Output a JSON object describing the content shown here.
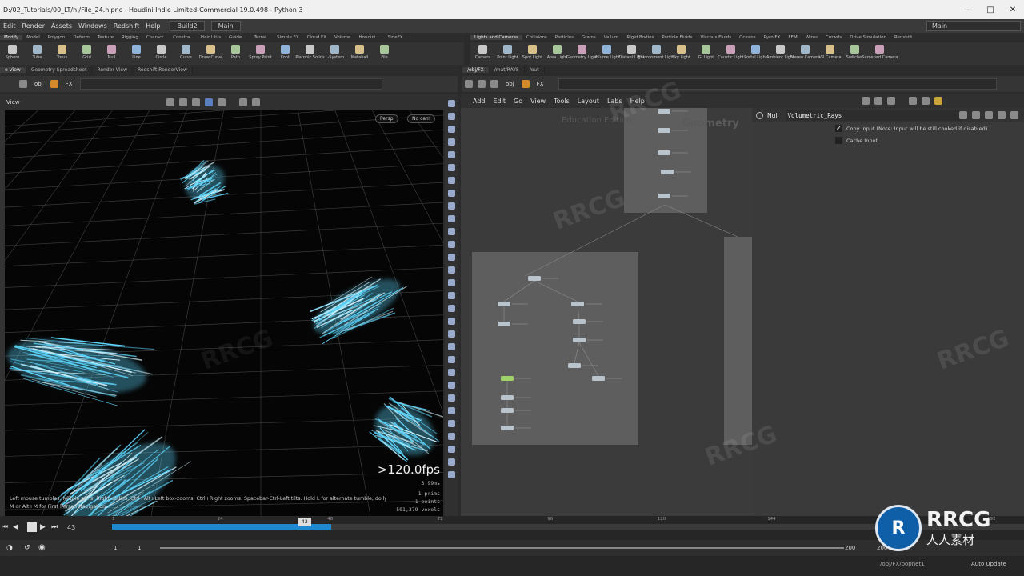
{
  "window": {
    "title": "D:/02_Tutorials/00_LT/hi/File_24.hipnc - Houdini Indie Limited-Commercial 19.0.498 - Python 3"
  },
  "menu": {
    "items": [
      "Edit",
      "Render",
      "Assets",
      "Windows",
      "Redshift",
      "Help"
    ],
    "desktop": "Build2",
    "workspace_left": "Main",
    "workspace_right": "Main"
  },
  "shelf_left": {
    "tabs": [
      "Modify",
      "Model",
      "Polygon",
      "Deform",
      "Texture",
      "Rigging",
      "Charact.",
      "Constra..",
      "Hair Utils",
      "Guide...",
      "Terrai..",
      "Simple FX",
      "Cloud FX",
      "Volume",
      "Houdini...",
      "SideFX..."
    ],
    "tools": [
      "Sphere",
      "Tube",
      "Torus",
      "Grid",
      "Null",
      "Line",
      "Circle",
      "Curve",
      "Draw Curve",
      "Path",
      "Spray Paint",
      "Font",
      "Platonic Solids",
      "L-System",
      "Metaball",
      "File"
    ]
  },
  "shelf_right": {
    "tabs": [
      "Lights and Cameras",
      "Collisions",
      "Particles",
      "Grains",
      "Vellum",
      "Rigid Bodies",
      "Particle Fluids",
      "Viscous Fluids",
      "Oceans",
      "Pyro FX",
      "FEM",
      "Wires",
      "Crowds",
      "Drive Simulation",
      "Redshift"
    ],
    "tools": [
      "Camera",
      "Point Light",
      "Spot Light",
      "Area Light",
      "Geometry Light",
      "Volume Light",
      "Distant Light",
      "Environment Light",
      "Sky Light",
      "GI Light",
      "Caustic Light",
      "Portal Light",
      "Ambient Light",
      "Stereo Camera",
      "VR Camera",
      "Switcher",
      "Gamepad Camera"
    ]
  },
  "left_panel_tabs": [
    "e View",
    "Geometry Spreadsheet",
    "Render View",
    "Redshift RenderView"
  ],
  "right_panel_tabs": [
    "/obj/FX",
    "/mat/RAYS",
    "/out"
  ],
  "left_path": [
    "obj",
    "FX"
  ],
  "right_path": [
    "obj",
    "FX"
  ],
  "viewport": {
    "label": "View",
    "persp": "Persp",
    "cam": "No cam",
    "fps": ">120.0fps",
    "ms": "3.99ms",
    "stats": [
      "1  prims",
      "1  points",
      "501,379  voxels"
    ],
    "help": "Left mouse tumbles. Middle pans. Right dollies. Ctrl+Alt+Left box-zooms. Ctrl+Right zooms. Spacebar-Ctrl-Left tilts. Hold L for alternate tumble, dolly, and zoom.",
    "help2": "M or Alt+M for First Person Navigation."
  },
  "network": {
    "menu": [
      "Add",
      "Edit",
      "Go",
      "View",
      "Tools",
      "Layout",
      "Labs",
      "Help"
    ],
    "watermark1": "Education Edition",
    "watermark2": "Geometry"
  },
  "params": {
    "node_type": "Null",
    "node_name": "Volumetric_Rays",
    "copy_input": "Copy Input (Note: Input will be still cooked if disabled)",
    "cache_input": "Cache Input"
  },
  "timeline": {
    "frame": "43",
    "current": "43",
    "ticks": [
      "1",
      "24",
      "48",
      "72",
      "96",
      "120",
      "144",
      "168",
      "192"
    ],
    "start": "1",
    "start2": "1",
    "end": "200",
    "end2": "200",
    "progress": 0.24
  },
  "status": {
    "path": "/obj/FX/popnet1",
    "auto": "Auto Update"
  },
  "brand": {
    "logo_text": "RRCG",
    "logo_sub": "人人素材",
    "watermark": "RRCG"
  },
  "colors": {
    "accent": "#1e88d0",
    "rays": "#5fd8ff",
    "node": "#8f8f8f"
  }
}
